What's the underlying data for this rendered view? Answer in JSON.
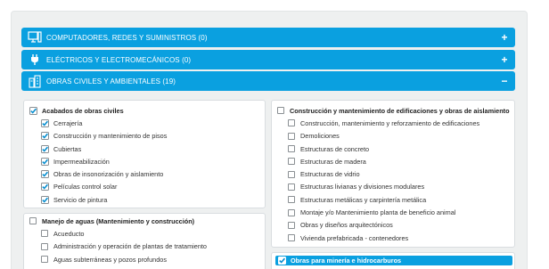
{
  "categories": [
    {
      "label": "COMPUTADORES, REDES Y SUMINISTROS (0)",
      "toggle": "+",
      "icon": "computer-icon"
    },
    {
      "label": "ELÉCTRICOS Y ELECTROMECÁNICOS (0)",
      "toggle": "+",
      "icon": "plug-icon"
    },
    {
      "label": "OBRAS CIVILES Y AMBIENTALES (19)",
      "toggle": "−",
      "icon": "building-icon"
    }
  ],
  "groups": {
    "acabados": {
      "title": "Acabados de obras civiles",
      "checked": true,
      "items": [
        "Cerrajería",
        "Construcción y mantenimiento de pisos",
        "Cubiertas",
        "Impermeabilización",
        "Obras de insonorización y aislamiento",
        "Películas control solar",
        "Servicio de pintura"
      ]
    },
    "aguas": {
      "title": "Manejo de aguas (Mantenimiento y construcción)",
      "checked": false,
      "items": [
        "Acueducto",
        "Administración y operación de plantas de tratamiento",
        "Aguas subterráneas y pozos profundos"
      ]
    },
    "construccion": {
      "title": "Construcción y mantenimiento de edificaciones y obras de aislamiento",
      "checked": false,
      "items": [
        "Construcción, mantenimiento y reforzamiento de edificaciones",
        "Demoliciones",
        "Estructuras de concreto",
        "Estructuras de madera",
        "Estructuras de vidrio",
        "Estructuras livianas y divisiones modulares",
        "Estructuras metálicas y carpintería metálica",
        "Montaje y/o Mantenimiento planta de beneficio animal",
        "Obras y diseños arquitectónicos",
        "Vivienda prefabricada - contenedores"
      ]
    },
    "mineria": {
      "title": "Obras para minería e hidrocarburos",
      "checked": true
    }
  },
  "colors": {
    "accent": "#0aa0e0",
    "check": "#0a8fd0"
  }
}
